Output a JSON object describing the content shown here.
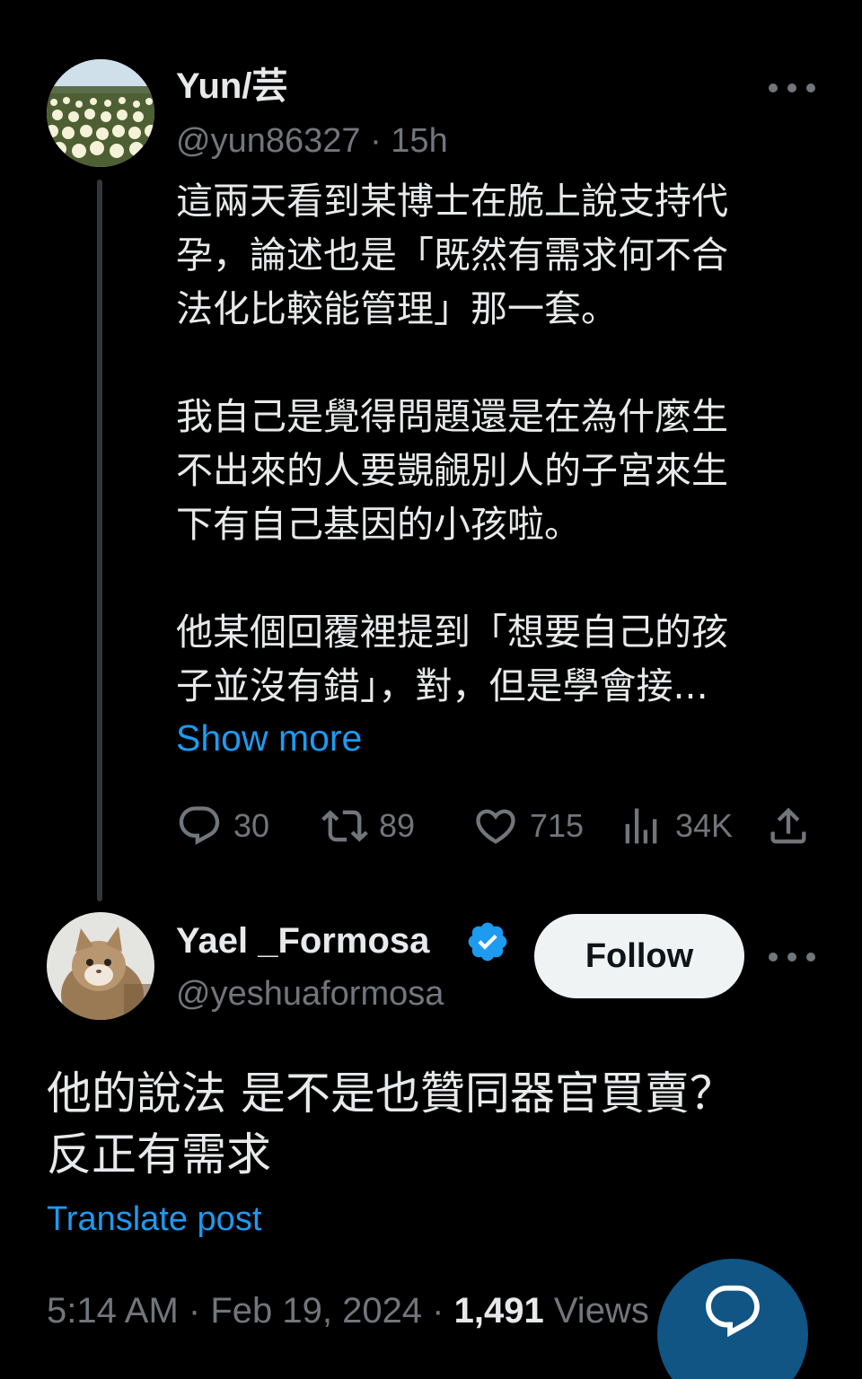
{
  "parent_post": {
    "author_name": "Yun/芸",
    "handle": "@yun86327",
    "separator": " · ",
    "age": "15h",
    "text": "這兩天看到某博士在脆上說支持代\n孕，論述也是「既然有需求何不合\n法化比較能管理」那一套。\n\n我自己是覺得問題還是在為什麼生\n不出來的人要覬覦別人的子宮來生\n下有自己基因的小孩啦。\n\n他某個回覆裡提到「想要自己的孩\n子並沒有錯」，對，但是學會接...",
    "show_more_label": "Show more",
    "stats": {
      "replies": "30",
      "reposts": "89",
      "likes": "715",
      "views": "34K"
    }
  },
  "reply_post": {
    "author_name": "Yael _Formosa",
    "handle": "@yeshuaformosa",
    "follow_label": "Follow",
    "text": "他的說法  是不是也贊同器官買賣？\n反正有需求",
    "translate_label": "Translate post",
    "time": "5:14 AM",
    "date": "Feb 19, 2024",
    "views_count": "1,491",
    "views_label": "Views"
  },
  "colors": {
    "background": "#000000",
    "text": "#e7e9ea",
    "secondary": "#71767b",
    "accent": "#1d9bf0"
  },
  "icons": [
    "more-icon",
    "reply-icon",
    "repost-icon",
    "like-icon",
    "views-icon",
    "share-icon",
    "verified-icon",
    "compose-reply-icon"
  ]
}
